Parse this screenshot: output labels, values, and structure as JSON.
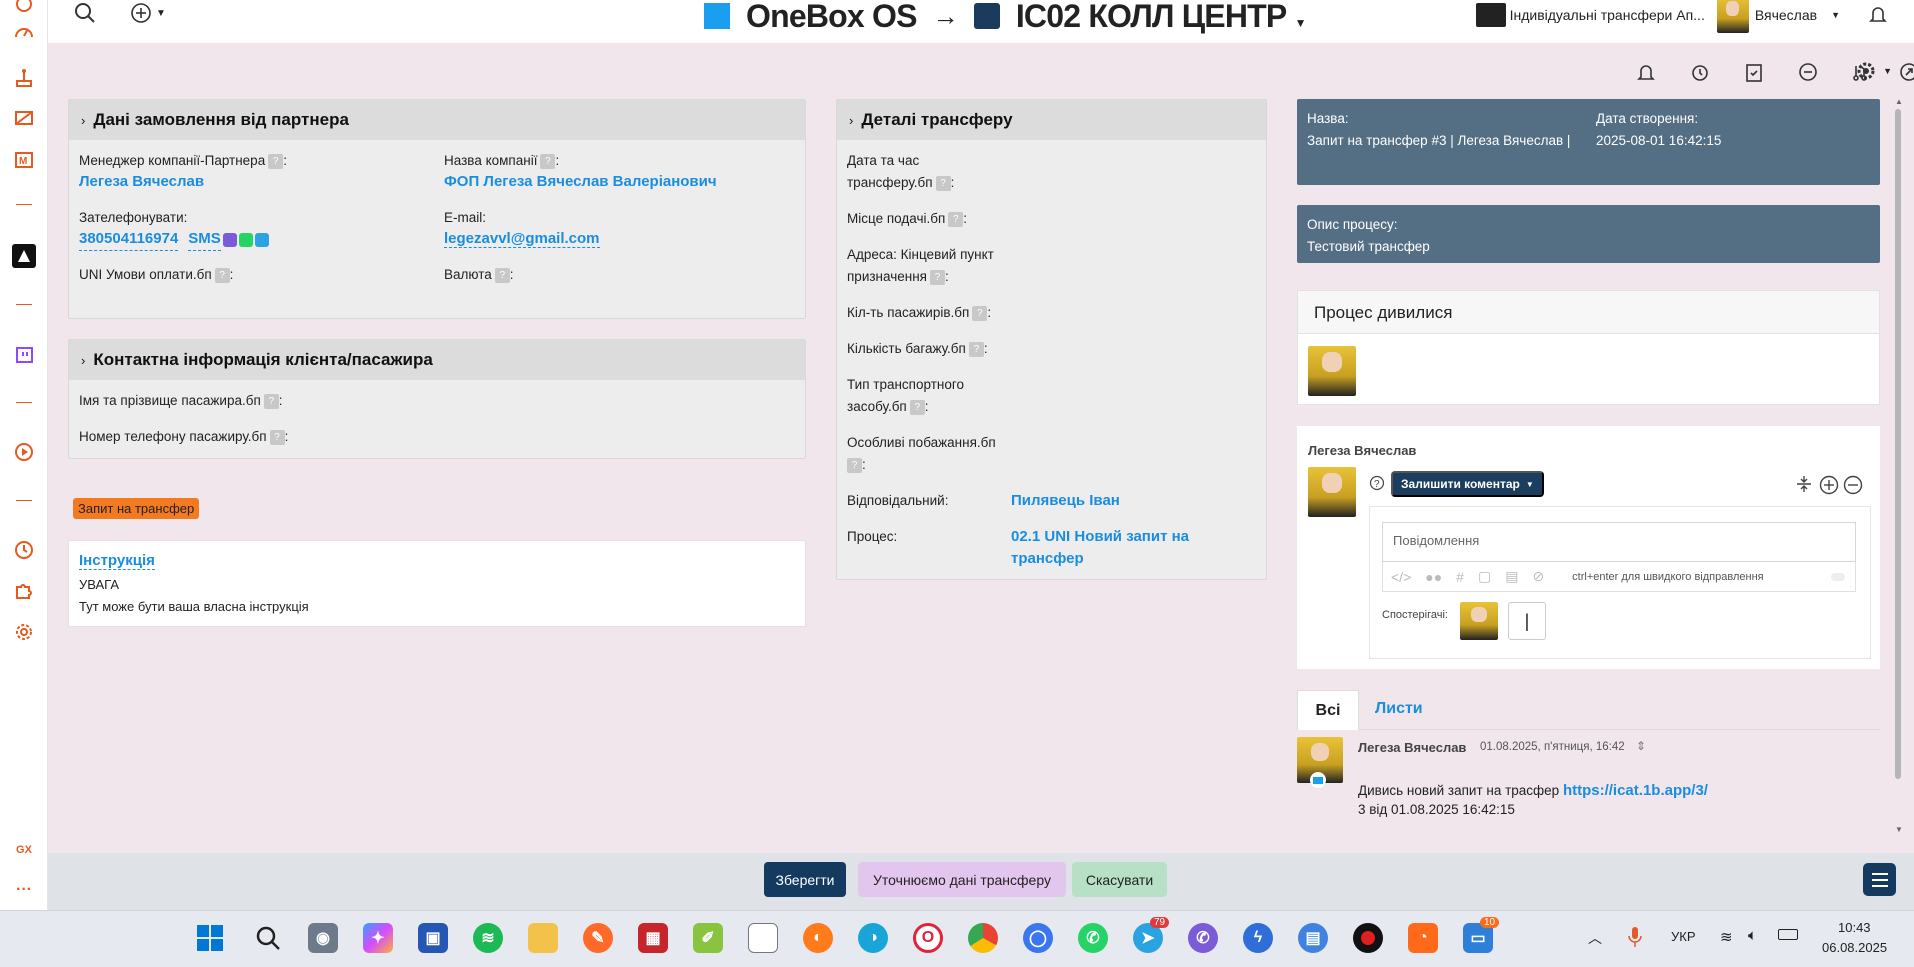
{
  "brand": {
    "app_name": "OneBox OS",
    "arrow": "→",
    "workspace": "IC02 КОЛЛ ЦЕНТР",
    "logo_color": "#1a9ff0"
  },
  "top_right": {
    "company": "Індивідуальні трансфери Ап...",
    "user": "Вячеслав"
  },
  "partner_panel": {
    "title": "Дані замовлення від партнера",
    "manager_label": "Менеджер компанії-Партнера",
    "manager_value": "Легеза Вячеслав",
    "company_label": "Назва компанії",
    "company_value": "ФОП Легеза Вячеслав Валеріанович",
    "call_label": "Зателефонувати:",
    "phone": "380504116974",
    "sms": "SMS",
    "email_label": "E-mail:",
    "email": "legezavvl@gmail.com",
    "payment_label": "UNI Умови оплати.бп",
    "currency_label": "Валюта"
  },
  "client_panel": {
    "title": "Контактна інформація клієнта/пасажира",
    "name_label": "Імя та прізвище пасажира.бп",
    "phone_label": "Номер телефону пасажиру.бп"
  },
  "badge": {
    "label": "Запит на трансфер",
    "color": "#f47a20"
  },
  "instruction": {
    "title": "Інструкція",
    "line1": "УВАГА",
    "line2": "Тут може бути ваша власна інструкція"
  },
  "transfer_panel": {
    "title": "Деталі трансферу",
    "date_label_1": "Дата та час",
    "date_label_2": "трансферу.бп",
    "place_label": "Місце подачі.бп",
    "address_label_1": "Адреса: Кінцевий пункт",
    "address_label_2": "призначення",
    "passengers_label": "Кіл-ть пасажирів.бп",
    "luggage_label": "Кількість багажу.бп",
    "vehicle_label_1": "Тип транспортного",
    "vehicle_label_2": "засобу.бп",
    "wishes_label": "Особливі побажання.бп",
    "responsible_label": "Відповідальний:",
    "responsible_value": "Пилявець Іван",
    "process_label": "Процес:",
    "process_value_1": "02.1 UNI Новий запит на",
    "process_value_2": "трансфер"
  },
  "info_panel": {
    "name_label": "Назва:",
    "name_value": "Запит на трансфер #3 | Легеза Вячеслав |",
    "created_label": "Дата створення:",
    "created_value": "2025-08-01 16:42:15",
    "desc_label": "Опис процесу:",
    "desc_value": "Тестовий трансфер"
  },
  "viewed": {
    "title": "Процес дивилися"
  },
  "comment": {
    "author": "Легеза Вячеслав",
    "leave_button": "Залишити коментар",
    "placeholder": "Повідомлення",
    "hint": "ctrl+enter для швидкого відправлення",
    "watchers_label": "Спостерігачі:"
  },
  "feed": {
    "tab_all": "Всі",
    "tab_letters": "Листи",
    "entry_author": "Легеза Вячеслав",
    "entry_date": "01.08.2025, п'ятниця, 16:42",
    "entry_text": "Дивись новий запит на трасфер",
    "entry_link": "https://icat.1b.app/3/",
    "entry_text2": "3 від 01.08.2025 16:42:15"
  },
  "bottom": {
    "save": "Зберегти",
    "clarify": "Уточнюємо дані трансферу",
    "cancel": "Скасувати"
  },
  "taskbar": {
    "lang": "УКР",
    "time": "10:43",
    "date": "06.08.2025",
    "badge_telegram": "79",
    "badge_last": "10"
  }
}
